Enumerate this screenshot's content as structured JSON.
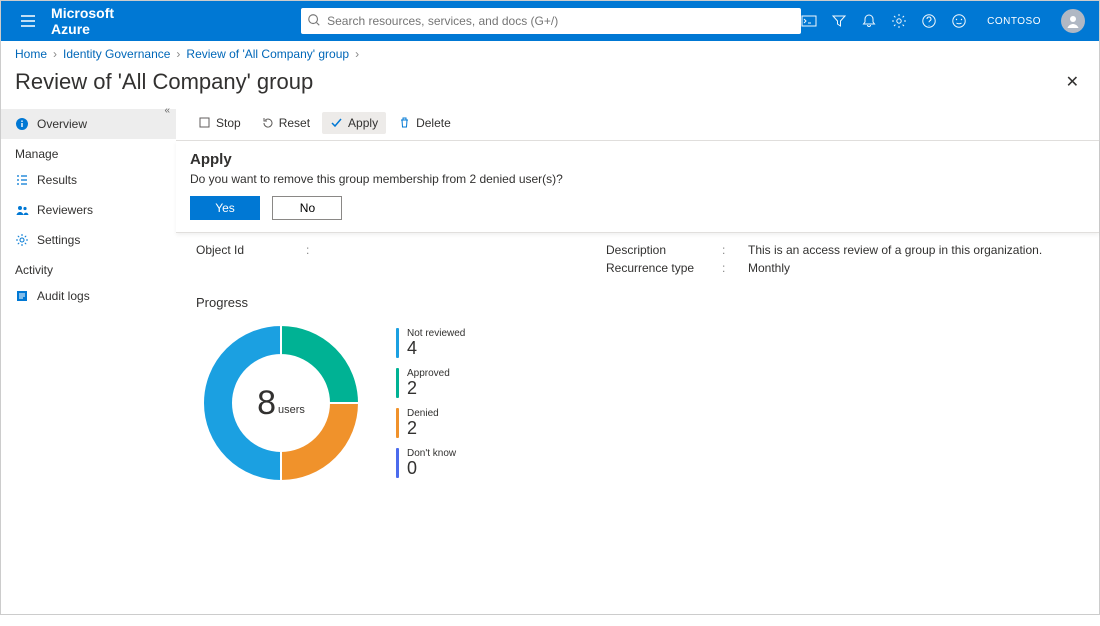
{
  "brand": "Microsoft Azure",
  "search": {
    "placeholder": "Search resources, services, and docs (G+/)"
  },
  "tenant": "CONTOSO",
  "breadcrumb": {
    "items": [
      "Home",
      "Identity Governance",
      "Review of 'All Company' group"
    ]
  },
  "page_title": "Review of 'All Company' group",
  "sidebar": {
    "overview": "Overview",
    "manage_label": "Manage",
    "results": "Results",
    "reviewers": "Reviewers",
    "settings": "Settings",
    "activity_label": "Activity",
    "audit_logs": "Audit logs"
  },
  "toolbar": {
    "stop": "Stop",
    "reset": "Reset",
    "apply": "Apply",
    "delete": "Delete"
  },
  "apply_dialog": {
    "title": "Apply",
    "message": "Do you want to remove this group membership from 2 denied user(s)?",
    "yes": "Yes",
    "no": "No"
  },
  "details": {
    "object_id_label": "Object Id",
    "object_id_value": "",
    "description_label": "Description",
    "description_value": "This is an access review of a group in this organization.",
    "recurrence_label": "Recurrence type",
    "recurrence_value": "Monthly"
  },
  "progress": {
    "title": "Progress",
    "total_value": "8",
    "total_unit": "users",
    "legend": {
      "not_reviewed": {
        "label": "Not reviewed",
        "value": "4",
        "color": "#1ba0e1"
      },
      "approved": {
        "label": "Approved",
        "value": "2",
        "color": "#00b294"
      },
      "denied": {
        "label": "Denied",
        "value": "2",
        "color": "#f0922b"
      },
      "dont_know": {
        "label": "Don't know",
        "value": "0",
        "color": "#4b6bed"
      }
    }
  },
  "chart_data": {
    "type": "pie",
    "title": "Progress",
    "total": 8,
    "unit": "users",
    "series": [
      {
        "name": "Not reviewed",
        "value": 4,
        "color": "#1ba0e1"
      },
      {
        "name": "Approved",
        "value": 2,
        "color": "#00b294"
      },
      {
        "name": "Denied",
        "value": 2,
        "color": "#f0922b"
      },
      {
        "name": "Don't know",
        "value": 0,
        "color": "#4b6bed"
      }
    ]
  }
}
